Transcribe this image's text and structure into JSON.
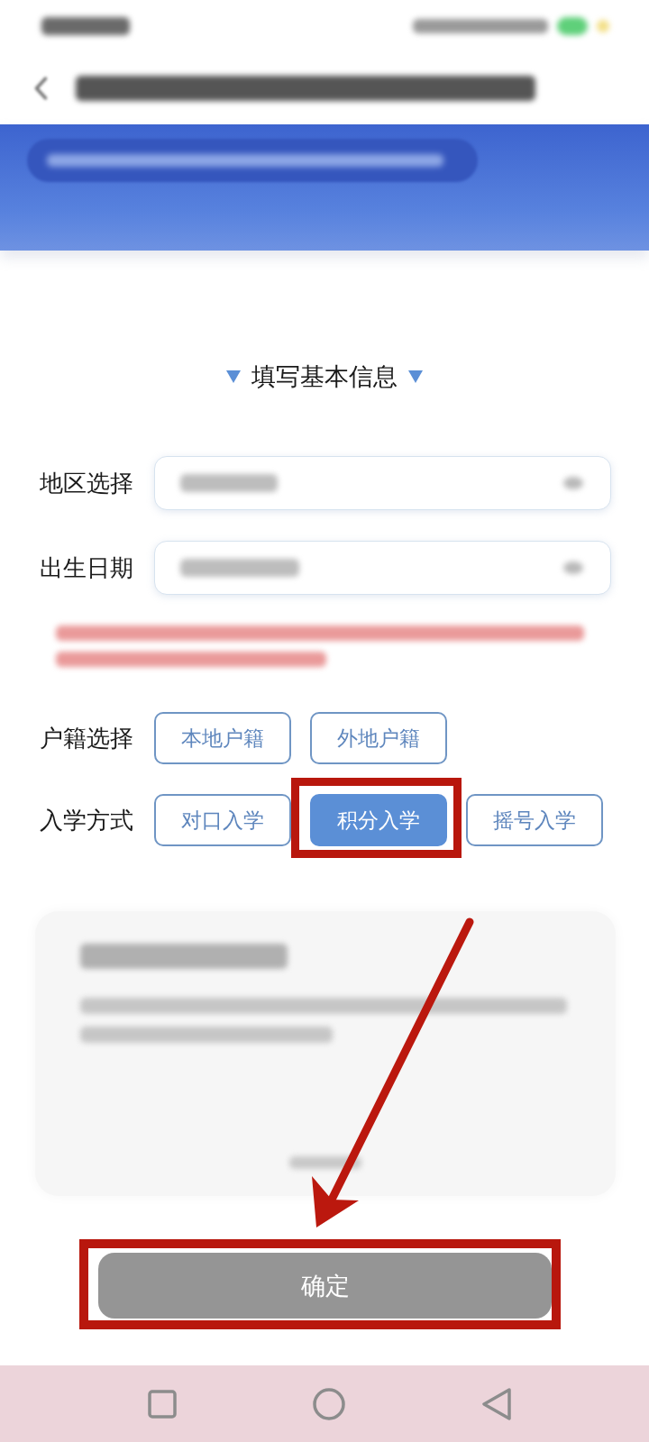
{
  "section_title": "填写基本信息",
  "fields": [
    {
      "label": "地区选择",
      "kind": "select"
    },
    {
      "label": "出生日期",
      "kind": "select"
    }
  ],
  "option_groups": [
    {
      "label": "户籍选择",
      "options": [
        {
          "label": "本地户籍",
          "selected": false,
          "highlighted": false
        },
        {
          "label": "外地户籍",
          "selected": false,
          "highlighted": false
        }
      ]
    },
    {
      "label": "入学方式",
      "options": [
        {
          "label": "对口入学",
          "selected": false,
          "highlighted": false
        },
        {
          "label": "积分入学",
          "selected": true,
          "highlighted": true
        },
        {
          "label": "摇号入学",
          "selected": false,
          "highlighted": false
        }
      ]
    }
  ],
  "confirm_button": {
    "label": "确定",
    "disabled": true,
    "highlighted": true
  }
}
